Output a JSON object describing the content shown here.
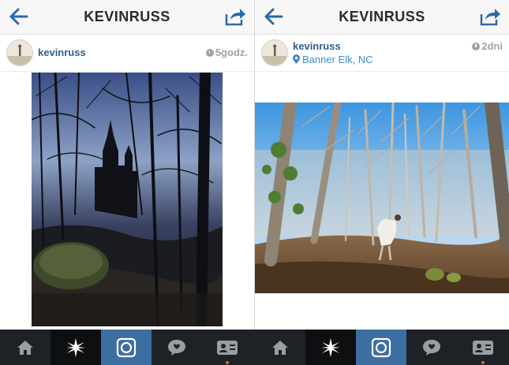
{
  "screens": [
    {
      "title": "KEVINRUSS",
      "post": {
        "username": "kevinruss",
        "time": "5godz."
      }
    },
    {
      "title": "KEVINRUSS",
      "post": {
        "username": "kevinruss",
        "time": "2dni",
        "location": "Banner Elk, NC"
      }
    }
  ],
  "colors": {
    "link": "#2f5f8a",
    "location": "#3f8cc8",
    "tabbar": "#1e2226",
    "active_tab": "#3d6ea1",
    "notification": "#ff5a1f"
  },
  "tabs": [
    {
      "icon": "home-icon"
    },
    {
      "icon": "explore-icon"
    },
    {
      "icon": "camera-icon"
    },
    {
      "icon": "activity-icon"
    },
    {
      "icon": "profile-icon"
    }
  ]
}
